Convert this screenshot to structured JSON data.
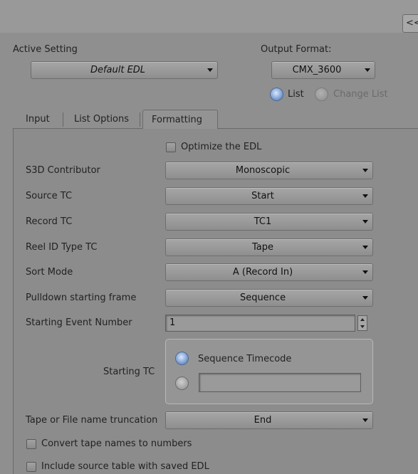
{
  "header": {
    "collapse_label": "<<",
    "active_setting_label": "Active Setting",
    "active_setting_value": "Default EDL",
    "output_format_label": "Output Format:",
    "output_format_value": "CMX_3600",
    "list_label": "List",
    "change_list_label": "Change List"
  },
  "tabs": [
    {
      "label": "Input"
    },
    {
      "label": "List Options"
    },
    {
      "label": "Formatting"
    }
  ],
  "formatting": {
    "optimize_label": "Optimize the EDL",
    "rows": [
      {
        "label": "S3D Contributor",
        "value": "Monoscopic"
      },
      {
        "label": "Source TC",
        "value": "Start"
      },
      {
        "label": "Record TC",
        "value": "TC1"
      },
      {
        "label": "Reel ID Type TC",
        "value": "Tape"
      },
      {
        "label": "Sort Mode",
        "value": "A (Record In)"
      },
      {
        "label": "Pulldown starting frame",
        "value": "Sequence"
      }
    ],
    "starting_event_label": "Starting Event Number",
    "starting_event_value": "1",
    "starting_tc_label": "Starting TC",
    "sequence_timecode_label": "Sequence Timecode",
    "truncation_label": "Tape or File name truncation",
    "truncation_value": "End",
    "convert_label": "Convert tape names to numbers",
    "include_label": "Include source table with saved EDL"
  },
  "colors": {
    "background": "#8f8f8f",
    "radio_selected": "#6f93c6"
  }
}
